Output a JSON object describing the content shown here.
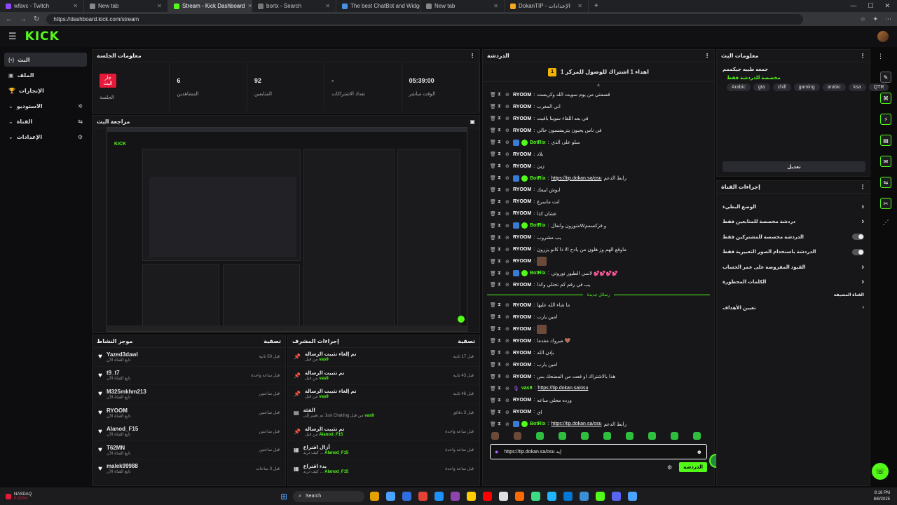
{
  "browser": {
    "tabs": [
      {
        "title": "wfavc - Twitch",
        "color": "#9146ff"
      },
      {
        "title": "New tab",
        "color": "#888888"
      },
      {
        "title": "Stream - Kick Dashboard",
        "color": "#53fc18",
        "active": true
      },
      {
        "title": "bortx - Search",
        "color": "#777777"
      },
      {
        "title": "The best ChatBot and Widgets fo",
        "color": "#4a90e2"
      },
      {
        "title": "New tab",
        "color": "#888888"
      },
      {
        "title": "DokanTIP - الإعدادات",
        "color": "#f5a623"
      }
    ],
    "url": "https://dashboard.kick.com/stream"
  },
  "brand": {
    "logo": "KICK",
    "accent": "#53fc18"
  },
  "sidebar": {
    "items": [
      {
        "label": "البث",
        "icon": "(•)",
        "active": true
      },
      {
        "label": "الملف",
        "icon": "▣"
      },
      {
        "label": "الإنجازات",
        "icon": "🏆"
      },
      {
        "label": "الاستوديو",
        "icon": "✲",
        "chev": "⌄"
      },
      {
        "label": "القناة",
        "icon": "⇆",
        "chev": "⌄"
      },
      {
        "label": "الإعدادات",
        "icon": "⚙",
        "chev": "⌄"
      }
    ]
  },
  "session": {
    "title": "معلومات الجلسة",
    "live_badge": "جار البث",
    "stats": [
      {
        "value": "",
        "label": "الجلسة"
      },
      {
        "value": "6",
        "label": "المشاهدين"
      },
      {
        "value": "92",
        "label": "المتابعين"
      },
      {
        "value": "-",
        "label": "تعداد الاشتراكات"
      },
      {
        "value": "05:39:00",
        "label": "الوقت مباشر"
      }
    ]
  },
  "preview": {
    "title": "مراجعة البث"
  },
  "activity": {
    "title": "موجز النشاط",
    "filter": "تصفية",
    "items": [
      {
        "name": "Yazed3dawi",
        "sub": "تابع القناة الآن",
        "time": "قبل 50 ثانية"
      },
      {
        "name": "t9_t7",
        "sub": "تابع القناة الآن",
        "time": "قبل ساعة واحدة"
      },
      {
        "name": "M325mkhm213",
        "sub": "تابع القناة الآن",
        "time": "قبل ساعتين"
      },
      {
        "name": "RYOOM",
        "sub": "تابع القناة الآن",
        "time": "قبل ساعتين"
      },
      {
        "name": "Alanod_F15",
        "sub": "تابع القناة الآن",
        "time": "قبل ساعتين"
      },
      {
        "name": "T62MN",
        "sub": "تابع القناة الآن",
        "time": "قبل ساعتين"
      },
      {
        "name": "malek99988",
        "sub": "تابع القناة الآن",
        "time": "قبل 3 ساعات"
      }
    ]
  },
  "modactions": {
    "title": "إجراءات المشرف",
    "filter": "تصفية",
    "items": [
      {
        "icon": "📌",
        "title": "تم إلغاء تثبيت الرسالة",
        "by": "vas9",
        "pre": "من قبل",
        "time": "قبل 17 ثانية"
      },
      {
        "icon": "📌",
        "title": "تم تثبيت الرسالة",
        "by": "vas9",
        "pre": "من قبل",
        "time": "قبل 43 ثانية"
      },
      {
        "icon": "📌",
        "title": "تم إلغاء تثبيت الرسالة",
        "by": "vas9",
        "pre": "من قبل",
        "time": "قبل 46 ثانية"
      },
      {
        "icon": "▤",
        "title": "الفئة",
        "by": "vas9",
        "pre": "تم تغيير إلى Just Chatting من قبل",
        "time": "قبل 3 دقائق"
      },
      {
        "icon": "📌",
        "title": "تم تثبيت الرسالة",
        "by": "Alanod_F15",
        "pre": "من قبل",
        "time": "قبل ساعة واحدة"
      },
      {
        "icon": "▦",
        "title": "أزال اقتراع",
        "by": "Alanod_F15",
        "pre": "كيف تريد ...",
        "time": "قبل ساعة واحدة"
      },
      {
        "icon": "▦",
        "title": "بدء اقتراع",
        "by": "Alanod_F15",
        "pre": "كيف تريد ...",
        "time": "قبل ساعة واحدة"
      }
    ]
  },
  "chat": {
    "title": "الدردشة",
    "pinned": "اهداء 1 اشتراك للوصول للمركز 1",
    "pinned_rank": "1",
    "new_messages": "رسائل جديدة",
    "before": [
      {
        "user": "RYOOM",
        "text": "قسمتي من يوم سويت الله وكريست"
      },
      {
        "user": "RYOOM",
        "text": "اني المغرب"
      },
      {
        "user": "RYOOM",
        "text": "في بعد اللقاء سوينا باقيت"
      },
      {
        "user": "RYOOM",
        "text": "في ناس يحبون يتريضسون حالي"
      },
      {
        "user": "BotRix",
        "bot": true,
        "text": "سلو على الذي"
      },
      {
        "user": "RYOOM",
        "text": "بلاد"
      },
      {
        "user": "RYOOM",
        "text": "زين"
      },
      {
        "user": "BotRix",
        "bot": true,
        "link": "https://tip.dokan.sa/osu",
        "text": "رابط الدعم"
      },
      {
        "user": "RYOOM",
        "text": "ابوش ابيعك"
      },
      {
        "user": "RYOOM",
        "text": "انت ماسرع"
      },
      {
        "user": "RYOOM",
        "text": "عشان كذا"
      },
      {
        "user": "BotRix",
        "bot": true,
        "text": "متوزون وانعالWو فزكسمم"
      },
      {
        "user": "RYOOM",
        "text": "يب مشروب"
      },
      {
        "user": "RYOOM",
        "text": "ماوقع الهم وز هلون من يادح الا ذا كانو يزرون"
      },
      {
        "user": "RYOOM",
        "emote": true,
        "text": ""
      },
      {
        "user": "BotRix",
        "bot": true,
        "text": "لاسي الطيور نوروتي 💕💕💕💕"
      },
      {
        "user": "RYOOM",
        "text": "يب في رقم كم تحتلي وكذا"
      }
    ],
    "after": [
      {
        "user": "RYOOM",
        "text": "ما شاء الله عليها"
      },
      {
        "user": "RYOOM",
        "text": "امين يارب"
      },
      {
        "user": "RYOOM",
        "emote": true,
        "text": ""
      },
      {
        "user": "RYOOM",
        "text": "مبروك مقدما 🤎"
      },
      {
        "user": "RYOOM",
        "text": "بإذن الله"
      },
      {
        "user": "RYOOM",
        "text": "امين يارب"
      },
      {
        "user": "RYOOM",
        "text": "هذا بالاشتراك او قعت من المضحك بس"
      },
      {
        "user": "vas9",
        "mod": true,
        "link": "https://tip.dokan.sa/osu",
        "text": ""
      },
      {
        "user": "RYOOM",
        "text": "ورده مجلي ساعه"
      },
      {
        "user": "RYOOM",
        "text": "اي"
      },
      {
        "user": "BotRix",
        "bot": true,
        "link": "https://tip.dokan.sa/osu",
        "text": "رابط الدعم"
      }
    ],
    "input_value": "https://tip.dokan.sa/osu  إيه",
    "send_label": "الدردشة"
  },
  "streaminfo": {
    "title": "معلومات البث",
    "stream_title": "جمعه طيبه جيكممم",
    "category": "مخصصة للدردشة فقط",
    "tags": [
      "Arabic",
      "gta",
      "chill",
      "gaming",
      "arabic",
      "ksa",
      "QTR"
    ],
    "edit_label": "تعديل"
  },
  "channelactions": {
    "title": "إجراءات القناة",
    "rows": [
      {
        "label": "الوضع البطيء",
        "type": "chev"
      },
      {
        "label": "دردشة مخصصة للمتابعين فقط",
        "type": "chev"
      },
      {
        "label": "الدردشة مخصصة للمشتركين فقط",
        "type": "toggle"
      },
      {
        "label": "الدردشة باستخدام الصور التعبيرية فقط",
        "type": "toggle"
      },
      {
        "label": "القيود المفروضة على عمر الحساب",
        "type": "chev"
      },
      {
        "label": "الكلمات المحظورة",
        "type": "chev"
      }
    ],
    "section": "القناة المضيفة",
    "goals": "تعيين الأهداف"
  },
  "taskbar": {
    "search": "Search",
    "time": "8:16 PM",
    "date": "8/8/2025",
    "ticker": "NASDAQ",
    "ticker_value": "0.81%+"
  }
}
